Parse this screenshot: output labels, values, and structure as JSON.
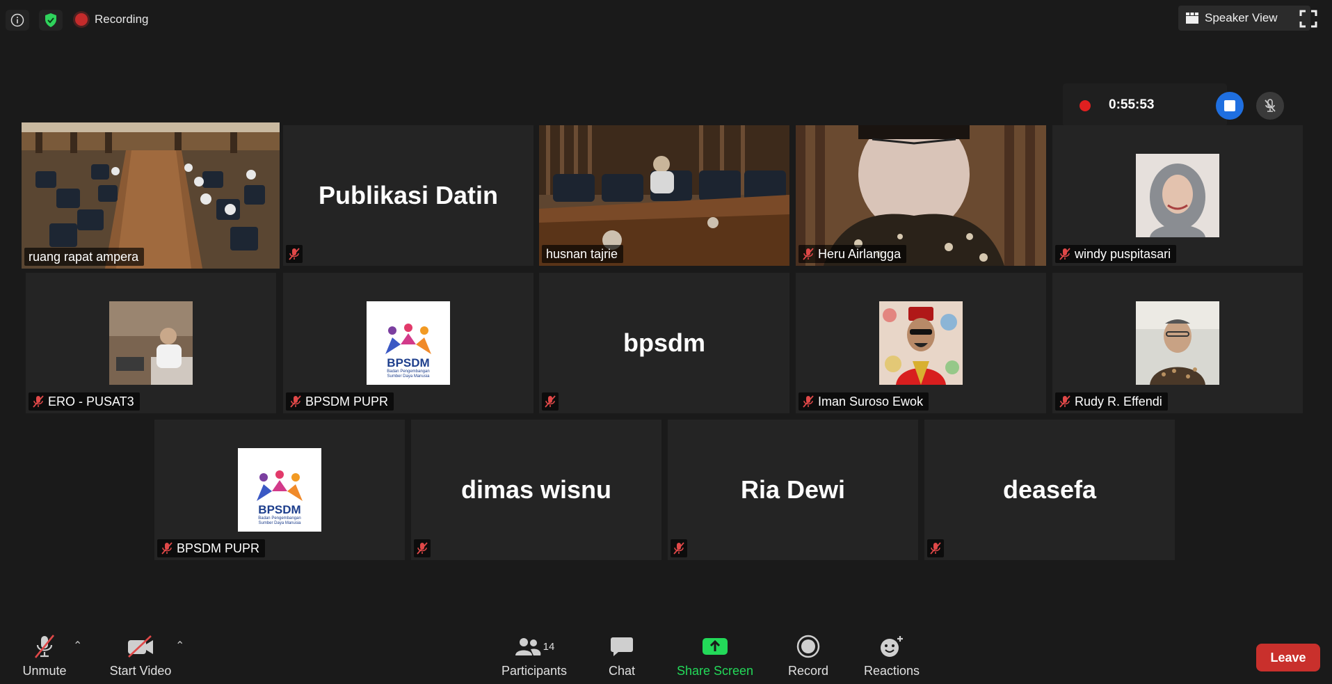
{
  "top_bar": {
    "recording_label": "Recording",
    "speaker_view_label": "Speaker View"
  },
  "recording_panel": {
    "elapsed": "0:55:53"
  },
  "tiles": [
    {
      "name": "ruang rapat ampera",
      "kind": "video",
      "scene": "conference-room-wide",
      "active": true,
      "muted": false
    },
    {
      "name": "",
      "display_name": "Publikasi Datin",
      "kind": "name",
      "muted": true
    },
    {
      "name": "husnan tajrie",
      "kind": "video",
      "scene": "conference-room-close",
      "muted": false
    },
    {
      "name": "Heru Airlangga",
      "kind": "video",
      "scene": "face-closeup",
      "muted": true
    },
    {
      "name": "windy puspitasari",
      "kind": "avatar",
      "avatar": "photo-woman-hijab",
      "muted": true
    },
    {
      "name": "ERO - PUSAT3",
      "kind": "avatar",
      "avatar": "photo-man-desk",
      "muted": true
    },
    {
      "name": "BPSDM PUPR",
      "kind": "avatar",
      "avatar": "bpsdm-logo",
      "muted": true
    },
    {
      "name": "",
      "display_name": "bpsdm",
      "kind": "name",
      "muted": true
    },
    {
      "name": "Iman Suroso Ewok",
      "kind": "avatar",
      "avatar": "photo-man-red-hat",
      "muted": true
    },
    {
      "name": "Rudy R. Effendi",
      "kind": "avatar",
      "avatar": "photo-man-glasses",
      "muted": true
    },
    {
      "name": "BPSDM PUPR",
      "kind": "avatar",
      "avatar": "bpsdm-logo",
      "muted": true
    },
    {
      "name": "",
      "display_name": "dimas wisnu",
      "kind": "name",
      "muted": true
    },
    {
      "name": "",
      "display_name": "Ria Dewi",
      "kind": "name",
      "muted": true
    },
    {
      "name": "",
      "display_name": "deasefa",
      "kind": "name",
      "muted": true
    }
  ],
  "logo": {
    "title": "BPSDM",
    "subtitle_line1": "Badan Pengembangan",
    "subtitle_line2": "Sumber Daya Manusia"
  },
  "toolbar": {
    "unmute_label": "Unmute",
    "start_video_label": "Start Video",
    "participants_label": "Participants",
    "participants_count": "14",
    "chat_label": "Chat",
    "share_screen_label": "Share Screen",
    "record_label": "Record",
    "reactions_label": "Reactions",
    "leave_label": "Leave"
  },
  "colors": {
    "background": "#1a1a1a",
    "tile": "#242424",
    "active_border": "#e8f27a",
    "share_green": "#23d959",
    "leave_red": "#c9302c",
    "stop_blue": "#1f6fe0"
  }
}
